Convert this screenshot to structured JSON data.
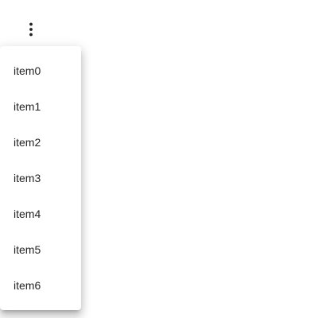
{
  "menu_button": {
    "icon": "more-vert-icon"
  },
  "menu": {
    "items": [
      {
        "label": "item0"
      },
      {
        "label": "item1"
      },
      {
        "label": "item2"
      },
      {
        "label": "item3"
      },
      {
        "label": "item4"
      },
      {
        "label": "item5"
      },
      {
        "label": "item6"
      }
    ]
  },
  "colors": {
    "text": "#212121",
    "icon": "#212121",
    "surface": "#ffffff"
  }
}
